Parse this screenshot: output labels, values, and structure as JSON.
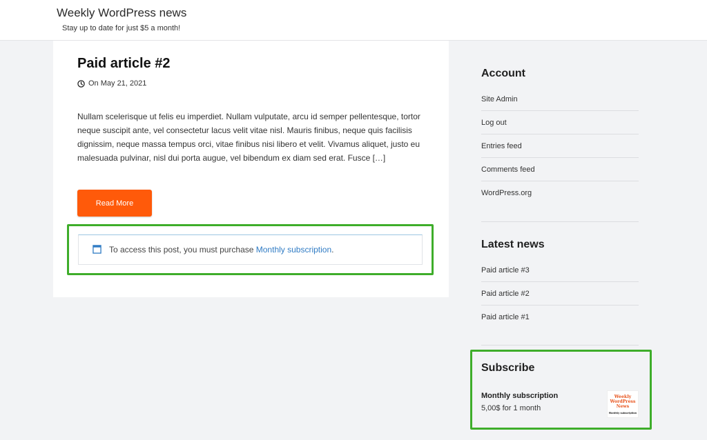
{
  "header": {
    "site_title": "Weekly WordPress news",
    "tagline": "Stay up to date for just $5 a month!"
  },
  "post": {
    "title": "Paid article #2",
    "date": "On May 21, 2021",
    "excerpt": "Nullam scelerisque ut felis eu imperdiet. Nullam vulputate, arcu id semper pellentesque, tortor neque suscipit ante, vel consectetur lacus velit vitae nisl. Mauris finibus, neque quis facilisis dignissim, neque massa tempus orci, vitae finibus nisi libero et velit. Vivamus aliquet, justo eu malesuada pulvinar, nisl dui porta augue, vel bibendum ex diam sed erat. Fusce […]",
    "read_more_label": "Read More",
    "notice_prefix": "To access this post, you must purchase ",
    "notice_link": "Monthly subscription",
    "notice_suffix": "."
  },
  "sidebar": {
    "account": {
      "title": "Account",
      "items": [
        "Site Admin",
        "Log out",
        "Entries feed",
        "Comments feed",
        "WordPress.org"
      ]
    },
    "latest_news": {
      "title": "Latest news",
      "items": [
        "Paid article #3",
        "Paid article #2",
        "Paid article #1"
      ]
    },
    "subscribe": {
      "title": "Subscribe",
      "product_name": "Monthly subscription",
      "price": "5,00$ for 1 month",
      "thumb_title_line1": "Weekly",
      "thumb_title_line2": "WordPress",
      "thumb_title_line3": "News",
      "thumb_caption": "Monthly subscription"
    }
  },
  "colors": {
    "accent_button": "#ff5a0a",
    "highlight_border": "#3ead2a",
    "link": "#2f7bc4"
  },
  "icons": {
    "date": "clock-icon",
    "notice": "window-icon"
  }
}
